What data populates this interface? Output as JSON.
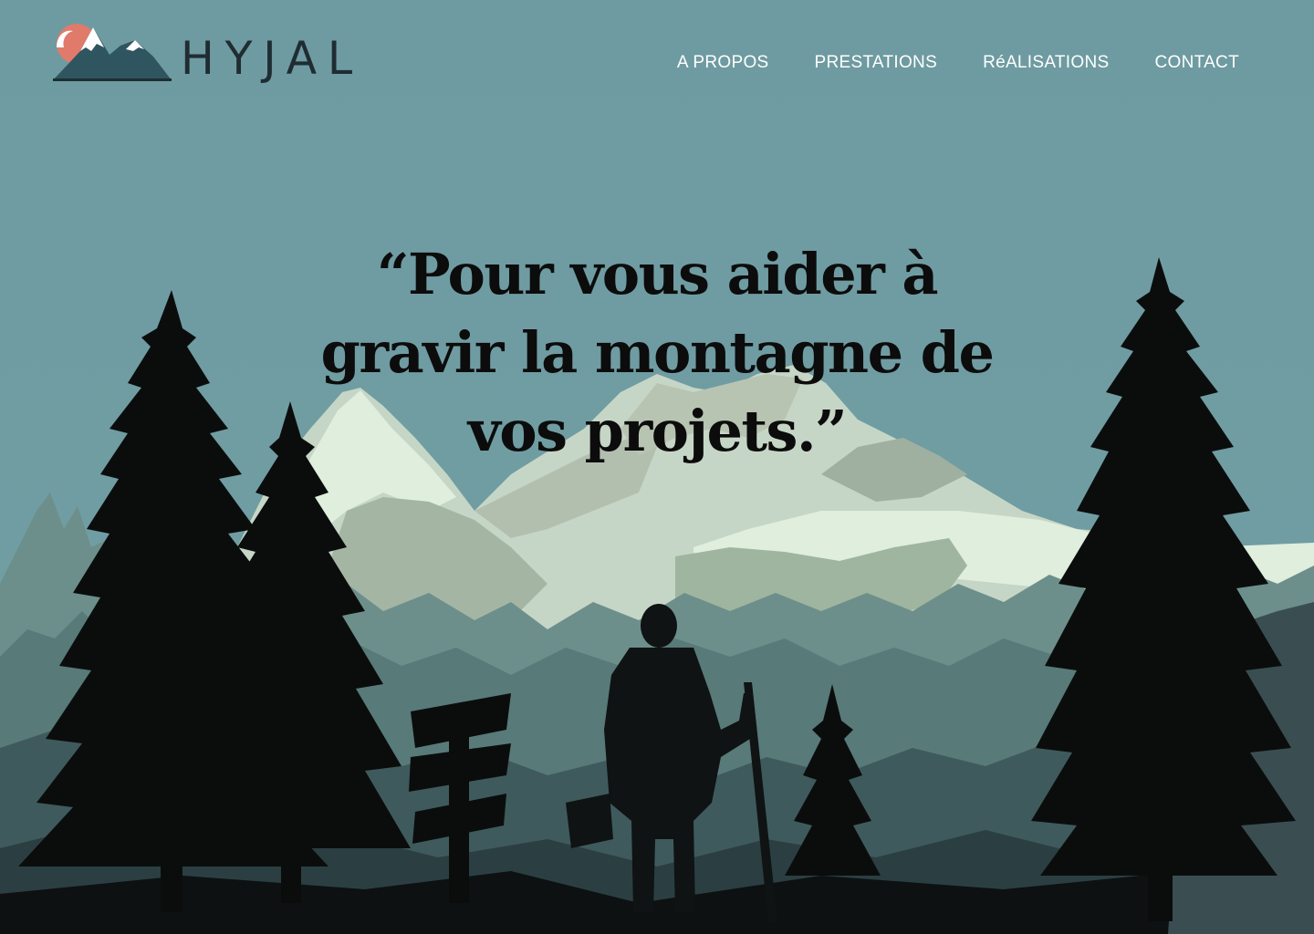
{
  "brand": {
    "name": "HYJAL",
    "colors": {
      "sky": "#6f9ca2",
      "sun": "#e07a6b",
      "logo_dark": "#1f2d33",
      "logo_mountain": "#2f5560"
    }
  },
  "nav": {
    "items": [
      {
        "label": "A PROPOS"
      },
      {
        "label": "PRESTATIONS"
      },
      {
        "label": "RéALISATIONS"
      },
      {
        "label": "CONTACT"
      }
    ]
  },
  "hero": {
    "quote": "“Pour vous aider à gravir la montagne de vos projets.”",
    "illustration": "hiker-with-walking-stick-facing-snowy-mountains-among-pine-trees"
  }
}
